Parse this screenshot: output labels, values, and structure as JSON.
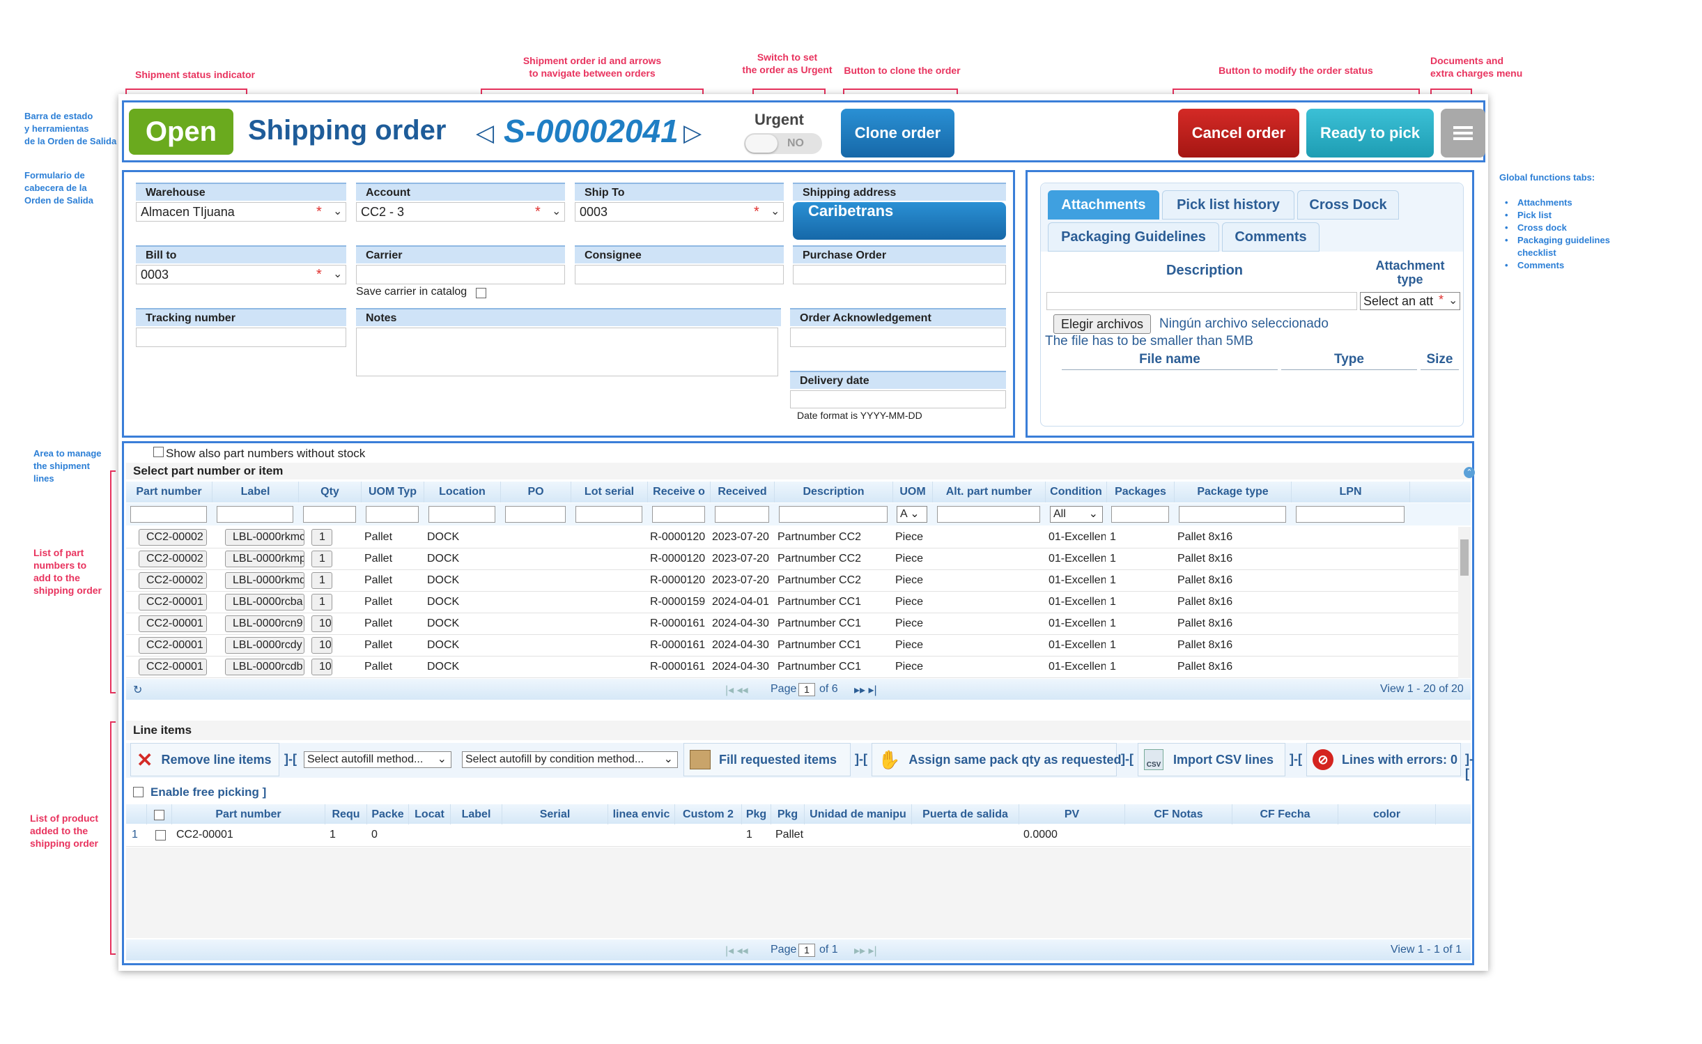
{
  "annotations": {
    "status_indicator": "Shipment status indicator",
    "order_id_nav": "Shipment order id and arrows\nto navigate between orders",
    "urgent_switch": "Switch to set\nthe order as Urgent",
    "clone_button": "Button to clone the order",
    "modify_status": "Button to modify the order status",
    "documents_menu": "Documents and\nextra charges menu",
    "toolbar_bar": "Barra de estado\ny herramientas\nde la Orden de Salida",
    "header_form": "Formulario de\ncabecera de la\nOrden de Salida",
    "lines_area": "Area to manage\nthe shipment\nlines",
    "part_list": "List of part\nnumbers to\nadd to the\nshipping order",
    "product_list": "List of product\nadded to the\nshipping order",
    "global_tabs_title": "Global functions tabs:",
    "global_tabs_items": [
      "Attachments",
      "Pick list",
      "Cross dock",
      "Packaging guidelines\nchecklist",
      "Comments"
    ]
  },
  "colors": {
    "accent": "#1f7ec4",
    "status_open": "#6aaa1e",
    "cancel": "#c1201f",
    "ready": "#2bb1c6",
    "frame": "#3a7ed8",
    "annotation": "#e8335e"
  },
  "toolbar": {
    "status": "Open",
    "title": "Shipping order",
    "prev_icon": "◁",
    "order_id": "S-00002041",
    "next_icon": "▷",
    "urgent_label": "Urgent",
    "urgent_value": "NO",
    "clone_label": "Clone order",
    "cancel_label": "Cancel order",
    "ready_label": "Ready to pick",
    "menu_icon": "hamburger-icon"
  },
  "form": {
    "warehouse_label": "Warehouse",
    "warehouse_value": "Almacen TIjuana",
    "account_label": "Account",
    "account_value": "CC2 - 3",
    "shipto_label": "Ship To",
    "shipto_value": "0003",
    "shipping_address_label": "Shipping address",
    "shipping_address_value": "Caribetrans",
    "billto_label": "Bill to",
    "billto_value": "0003",
    "carrier_label": "Carrier",
    "carrier_value": "",
    "save_carrier_label": "Save carrier in catalog",
    "consignee_label": "Consignee",
    "consignee_value": "",
    "po_label": "Purchase Order",
    "po_value": "",
    "tracking_label": "Tracking number",
    "tracking_value": "",
    "notes_label": "Notes",
    "notes_value": "",
    "ack_label": "Order Acknowledgement",
    "ack_value": "",
    "delivery_label": "Delivery date",
    "delivery_value": "",
    "date_format": "Date format is YYYY-MM-DD"
  },
  "tabs": {
    "row1": [
      "Attachments",
      "Pick list history",
      "Cross Dock"
    ],
    "row2": [
      "Packaging Guidelines",
      "Comments"
    ],
    "description_header": "Description",
    "attachment_type_header": "Attachment type",
    "attachment_type_select": "Select an att",
    "choose_files": "Elegir archivos",
    "no_file": "Ningún archivo seleccionado",
    "size_note": "The file has to be smaller than 5MB",
    "file_name_header": "File name",
    "type_header": "Type",
    "size_header": "Size"
  },
  "parts": {
    "show_without_stock": "Show also part numbers without stock",
    "title": "Select part number or item",
    "columns": [
      "Part number",
      "Label",
      "Qty",
      "UOM Typ",
      "Location",
      "PO",
      "Lot serial",
      "Receive o",
      "Received",
      "Description",
      "UOM",
      "Alt. part number",
      "Condition",
      "Packages",
      "Package type",
      "LPN"
    ],
    "uom_filter": "A",
    "condition_filter": "All",
    "rows": [
      [
        "CC2-00002",
        "LBL-0000rkmc",
        "1",
        "Pallet",
        "DOCK",
        "",
        "",
        "R-0000120",
        "2023-07-20",
        "Partnumber CC2",
        "Piece",
        "",
        "01-Excellen",
        "1",
        "Pallet 8x16",
        ""
      ],
      [
        "CC2-00002",
        "LBL-0000rkmp",
        "1",
        "Pallet",
        "DOCK",
        "",
        "",
        "R-0000120",
        "2023-07-20",
        "Partnumber CC2",
        "Piece",
        "",
        "01-Excellen",
        "1",
        "Pallet 8x16",
        ""
      ],
      [
        "CC2-00002",
        "LBL-0000rkmq",
        "1",
        "Pallet",
        "DOCK",
        "",
        "",
        "R-0000120",
        "2023-07-20",
        "Partnumber CC2",
        "Piece",
        "",
        "01-Excellen",
        "1",
        "Pallet 8x16",
        ""
      ],
      [
        "CC2-00001",
        "LBL-0000rcba",
        "1",
        "Pallet",
        "DOCK",
        "",
        "",
        "R-0000159",
        "2024-04-01",
        "Partnumber CC1",
        "Piece",
        "",
        "01-Excellen",
        "1",
        "Pallet 8x16",
        ""
      ],
      [
        "CC2-00001",
        "LBL-0000rcn9",
        "10",
        "Pallet",
        "DOCK",
        "",
        "",
        "R-0000161",
        "2024-04-30",
        "Partnumber CC1",
        "Piece",
        "",
        "01-Excellen",
        "1",
        "Pallet 8x16",
        ""
      ],
      [
        "CC2-00001",
        "LBL-0000rcdy",
        "10",
        "Pallet",
        "DOCK",
        "",
        "",
        "R-0000161",
        "2024-04-30",
        "Partnumber CC1",
        "Piece",
        "",
        "01-Excellen",
        "1",
        "Pallet 8x16",
        ""
      ],
      [
        "CC2-00001",
        "LBL-0000rcdb",
        "10",
        "Pallet",
        "DOCK",
        "",
        "",
        "R-0000161",
        "2024-04-30",
        "Partnumber CC1",
        "Piece",
        "",
        "01-Excellen",
        "1",
        "Pallet 8x16",
        ""
      ]
    ],
    "pager_page": "Page",
    "pager_num": "1",
    "pager_of": "of 6",
    "view": "View 1 - 20 of 20"
  },
  "lines": {
    "title": "Line items",
    "remove": "Remove line items",
    "autofill": "Select autofill method...",
    "autofill_condition": "Select autofill by condition method...",
    "fill": "Fill requested items",
    "assign": "Assign same pack qty as requested",
    "import": "Import CSV lines",
    "errors": "Lines with errors: 0",
    "free_picking": "Enable free picking ]",
    "columns": [
      "Part number",
      "Requ",
      "Packe",
      "Locat",
      "Label",
      "Serial",
      "linea envic",
      "Custom 2",
      "Pkg",
      "Pkg",
      "Unidad de manipu",
      "Puerta de salida",
      "PV",
      "CF Notas",
      "CF Fecha",
      "color"
    ],
    "rows": [
      {
        "num": "1",
        "cells": [
          "CC2-00001",
          "1",
          "0",
          "",
          "",
          "",
          "",
          "",
          "1",
          "Pallet",
          "",
          "",
          "0.0000",
          "",
          "",
          ""
        ]
      }
    ],
    "pager_page": "Page",
    "pager_num": "1",
    "pager_of": "of 1",
    "view": "View 1 - 1 of 1"
  }
}
